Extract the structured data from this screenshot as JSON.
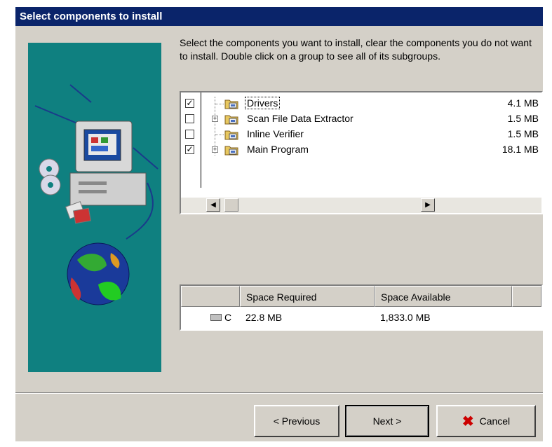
{
  "window": {
    "title": "Select components to install"
  },
  "instructions": "Select the components you want to install, clear the components you do not want to install. Double click on a group to see all of its subgroups.",
  "components": [
    {
      "name": "Drivers",
      "size": "4.1 MB",
      "checked": true,
      "expandable": false,
      "selected": true
    },
    {
      "name": "Scan File Data Extractor",
      "size": "1.5 MB",
      "checked": false,
      "expandable": true,
      "selected": false
    },
    {
      "name": "Inline Verifier",
      "size": "1.5 MB",
      "checked": false,
      "expandable": false,
      "selected": false
    },
    {
      "name": "Main Program",
      "size": "18.1 MB",
      "checked": true,
      "expandable": true,
      "selected": false
    }
  ],
  "space_table": {
    "headers": [
      "Space Required",
      "Space Available"
    ],
    "rows": [
      {
        "drive": "C",
        "required": "22.8 MB",
        "available": "1,833.0 MB"
      }
    ]
  },
  "buttons": {
    "previous": "< Previous",
    "next": "Next >",
    "cancel": "Cancel"
  },
  "colors": {
    "titlebar": "#0a246a",
    "side_panel": "#0f8080",
    "window": "#d4d0c8",
    "cancel_x": "#cc0000"
  }
}
